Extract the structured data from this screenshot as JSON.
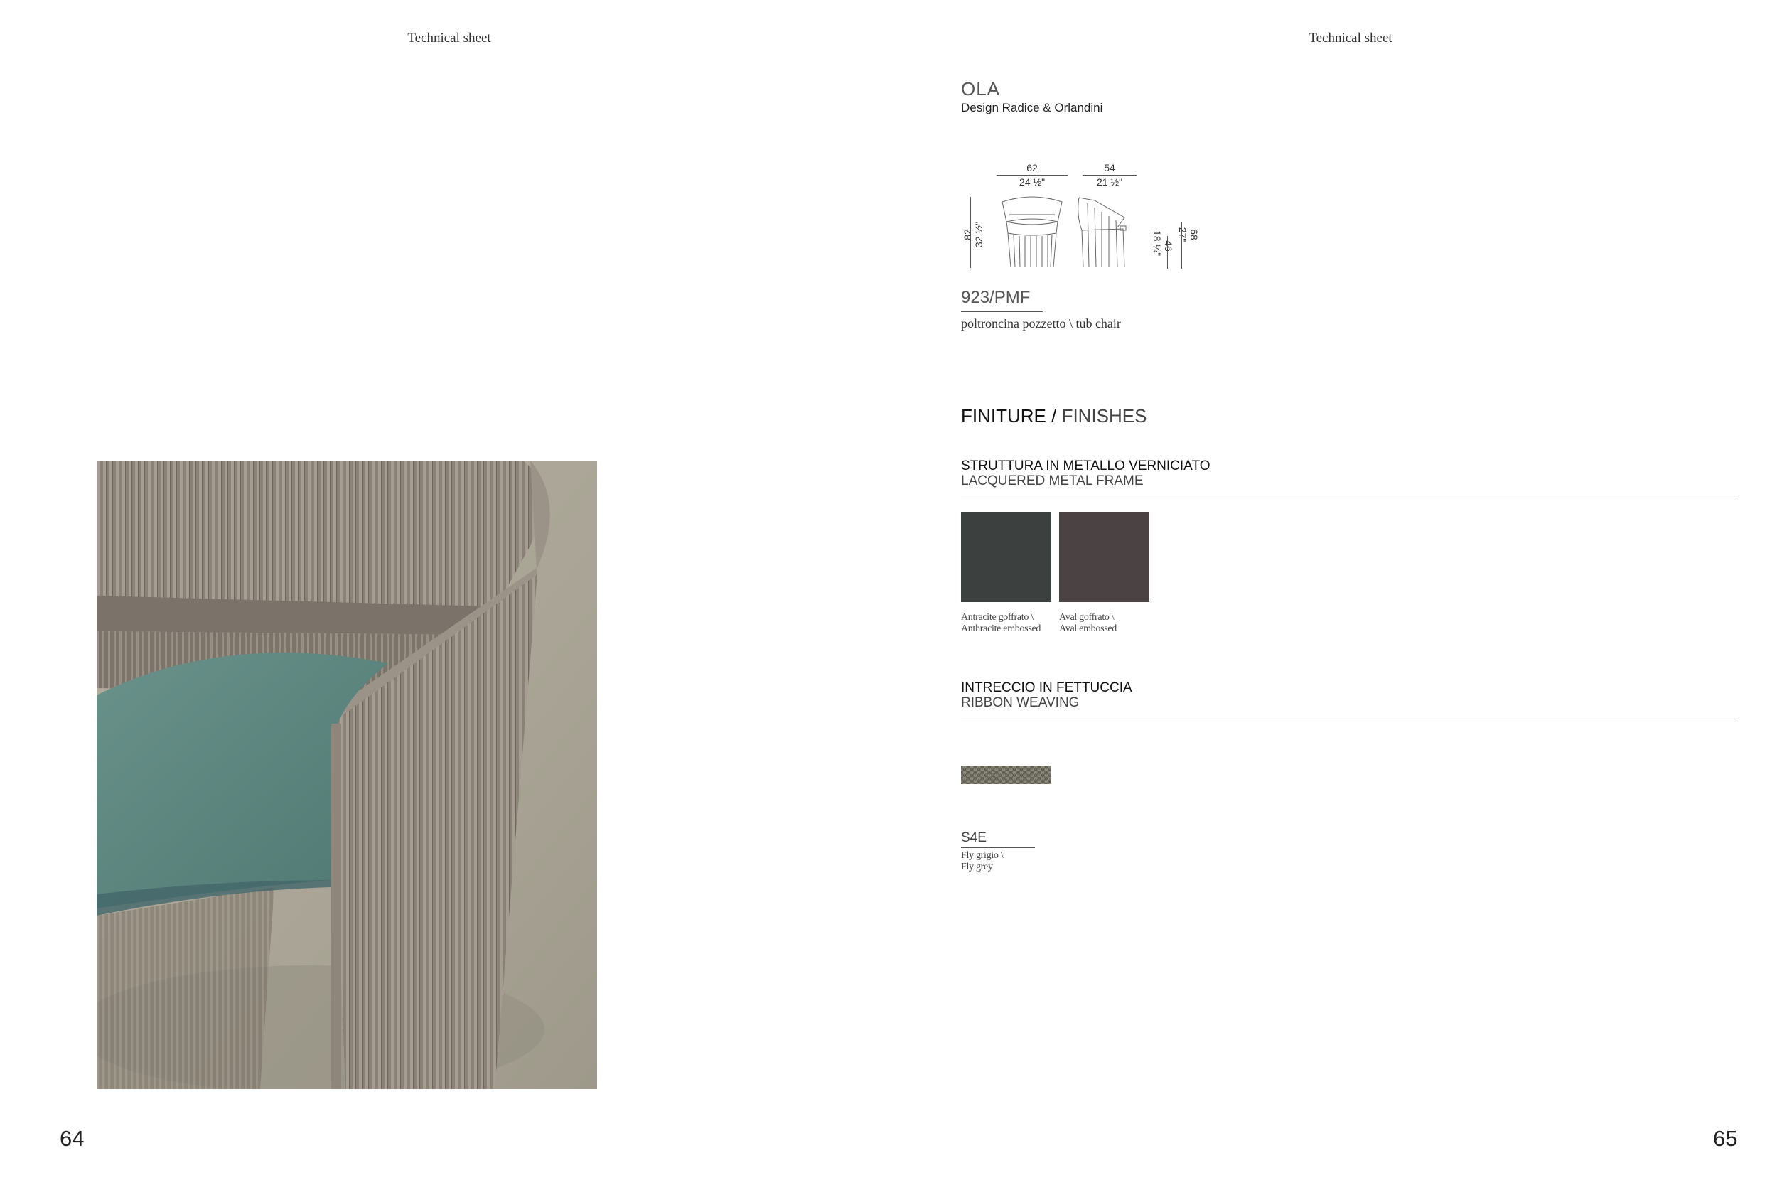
{
  "left_page": {
    "running_head": "Technical sheet",
    "page_number": "64"
  },
  "right_page": {
    "running_head": "Technical sheet",
    "page_number": "65"
  },
  "product": {
    "name": "OLA",
    "designer": "Design Radice & Orlandini",
    "code": "923/PMF",
    "description": "poltroncina pozzetto \\ tub chair"
  },
  "dimensions": {
    "front_width_cm": "62",
    "front_width_in": "24 ½\"",
    "side_depth_cm": "54",
    "side_depth_in": "21 ½\"",
    "height_cm": "82",
    "height_in": "32 ½\"",
    "seat_height_cm": "46",
    "seat_height_in": "18 ¼\"",
    "arm_height_cm": "68",
    "arm_height_in": "27\""
  },
  "finishes": {
    "title_it": "FINITURE /",
    "title_en": "FINISHES",
    "frame": {
      "label_it": "STRUTTURA IN METALLO VERNICIATO",
      "label_en": "LACQUERED METAL FRAME",
      "swatches": [
        {
          "line1": "Antracite goffrato \\",
          "line2": "Anthracite embossed",
          "color": "#3c4140"
        },
        {
          "line1": "Aval goffrato \\",
          "line2": "Aval embossed",
          "color": "#4a4243"
        }
      ]
    },
    "weaving": {
      "label_it": "INTRECCIO IN FETTUCCIA",
      "label_en": "RIBBON WEAVING",
      "swatches": [
        {
          "code": "S4E",
          "line1": "Fly grigio \\",
          "line2": "Fly grey",
          "color": "#6f6d61"
        }
      ]
    }
  },
  "photo": {
    "subject": "chair-photo",
    "colors": {
      "floor": "#aaa596",
      "frame": "#8d8478",
      "cushion": "#5e8680"
    }
  }
}
